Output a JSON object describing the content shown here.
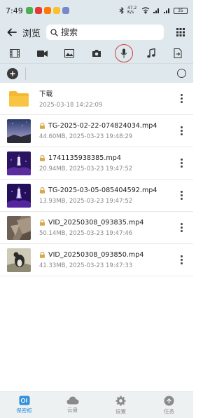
{
  "status_bar": {
    "time": "7:49",
    "network_speed": "47.2 K/s",
    "battery": "35"
  },
  "header": {
    "title": "浏览",
    "search_placeholder": "搜索"
  },
  "categories": [
    {
      "icon": "film-strip-icon",
      "active": false
    },
    {
      "icon": "video-camera-icon",
      "active": false
    },
    {
      "icon": "image-icon",
      "active": false
    },
    {
      "icon": "camera-icon",
      "active": false
    },
    {
      "icon": "microphone-icon",
      "active": true
    },
    {
      "icon": "music-note-icon",
      "active": false
    },
    {
      "icon": "file-export-icon",
      "active": false
    }
  ],
  "files": [
    {
      "name": "下载",
      "meta": "2025-03-18 14:22:09",
      "type": "folder"
    },
    {
      "name": "TG-2025-02-22-074824034.mp4",
      "meta": "44.60MB, 2025-03-23 19:48:29",
      "type": "video",
      "thumb": "night-sky"
    },
    {
      "name": "1741135938385.mp4",
      "meta": "20.94MB, 2025-03-23 19:47:52",
      "type": "video",
      "thumb": "purple-crowd"
    },
    {
      "name": "TG-2025-03-05-085404592.mp4",
      "meta": "13.93MB, 2025-03-23 19:47:52",
      "type": "video",
      "thumb": "purple-crowd"
    },
    {
      "name": "VID_20250308_093835.mp4",
      "meta": "50.14MB, 2025-03-23 19:47:46",
      "type": "video",
      "thumb": "rock"
    },
    {
      "name": "VID_20250308_093850.mp4",
      "meta": "41.33MB, 2025-03-23 19:47:33",
      "type": "video",
      "thumb": "bird"
    }
  ],
  "bottom_nav": [
    {
      "label": "保密柜",
      "icon": "vault-icon",
      "active": true
    },
    {
      "label": "云盘",
      "icon": "cloud-icon",
      "active": false
    },
    {
      "label": "设置",
      "icon": "gear-icon",
      "active": false
    },
    {
      "label": "任务",
      "icon": "tasks-icon",
      "active": false
    }
  ],
  "colors": {
    "header_bg": "#dfe8ec",
    "accent": "#2f8fdc",
    "active_circle": "#d04040",
    "folder": "#f5b82e"
  }
}
